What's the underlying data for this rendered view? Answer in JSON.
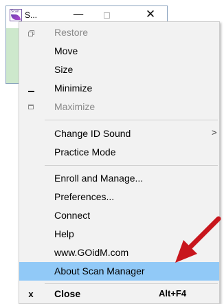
{
  "app_window": {
    "title": "S...",
    "icon_text": "Scan",
    "minimize_glyph": "—",
    "close_glyph": "✕"
  },
  "menu": {
    "items": [
      {
        "label": "Restore",
        "icon": "restore-icon",
        "disabled": true
      },
      {
        "label": "Move"
      },
      {
        "label": "Size"
      },
      {
        "label": "Minimize",
        "icon": "minimize-icon"
      },
      {
        "label": "Maximize",
        "icon": "maximize-icon",
        "disabled": true
      },
      {
        "label": "Change ID Sound",
        "submenu_arrow": ">"
      },
      {
        "label": "Practice Mode"
      },
      {
        "label": "Enroll and Manage..."
      },
      {
        "label": "Preferences..."
      },
      {
        "label": "Connect"
      },
      {
        "label": "Help"
      },
      {
        "label": "www.GOidM.com"
      },
      {
        "label": "About Scan Manager",
        "highlighted": true
      },
      {
        "label": "Close",
        "icon": "close-icon",
        "icon_glyph": "x",
        "shortcut": "Alt+F4",
        "bold": true
      }
    ]
  },
  "colors": {
    "highlight": "#91c9f7",
    "annotation_arrow": "#c8161d",
    "app_body": "#cde8cc"
  }
}
